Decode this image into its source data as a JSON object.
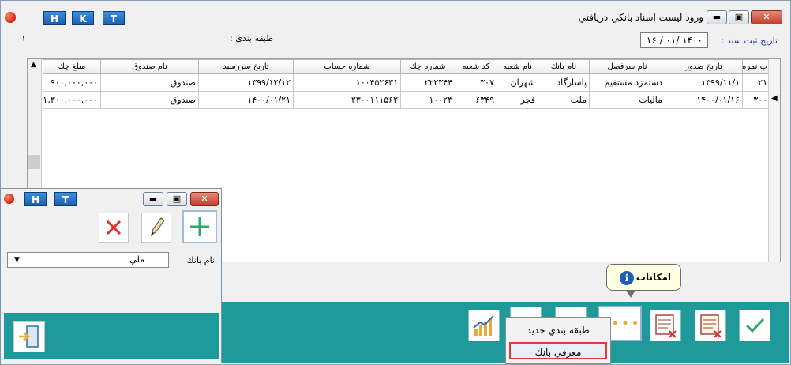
{
  "main": {
    "title": "ورود ليست اسناد بانكي دريافتي",
    "hkt": [
      "H",
      "K",
      "T"
    ],
    "date_label": "تاريخ ثبت سند :",
    "date_value": "۱۴۰۰ /۰۱ / ۱۶",
    "category_label": "طبقه بندي :",
    "edge_number": "۱",
    "columns": [
      "پ نمره",
      "تاريخ صدور",
      "نام سرفصل",
      "نام بانك",
      "نام شعبه",
      "كد شعبه",
      "شماره چك",
      "شماره حساب",
      "تاريخ سررسيد",
      "نام صندوق",
      "مبلغ چك"
    ],
    "rows": [
      [
        "۲۱",
        "۱۳۹۹/۱۱/۱",
        "دستمزد مستقيم",
        "پاسارگاد",
        "شهران",
        "۳۰۷",
        "۲۲۲۳۴۴",
        "۱۰۰۴۵۲۶۳۱",
        "۱۳۹۹/۱۲/۱۲",
        "صندوق",
        "۹۰۰,۰۰۰,۰۰۰"
      ],
      [
        "۳۰۰",
        "۱۴۰۰/۰۱/۱۶",
        "ماليات",
        "ملت",
        "فجر",
        "۶۳۴۹",
        "۱۰۰۲۳",
        "۲۳۰۰۱۱۱۵۶۲",
        "۱۴۰۰/۰۱/۲۱",
        "صندوق",
        "۱,۳۰۰,۰۰۰,۰۰۰"
      ]
    ]
  },
  "tooltip": {
    "text": "امكانات"
  },
  "menu": {
    "items": [
      "طبقه بندي جديد",
      "معرفي بانك"
    ]
  },
  "win2": {
    "hkt": [
      "H",
      "T"
    ],
    "bank_label": "نام بانك",
    "bank_value": "ملي"
  },
  "colors": {
    "teal": "#1f9a9a",
    "highlight": "#e03a3a",
    "check_green": "#2fa66a"
  }
}
